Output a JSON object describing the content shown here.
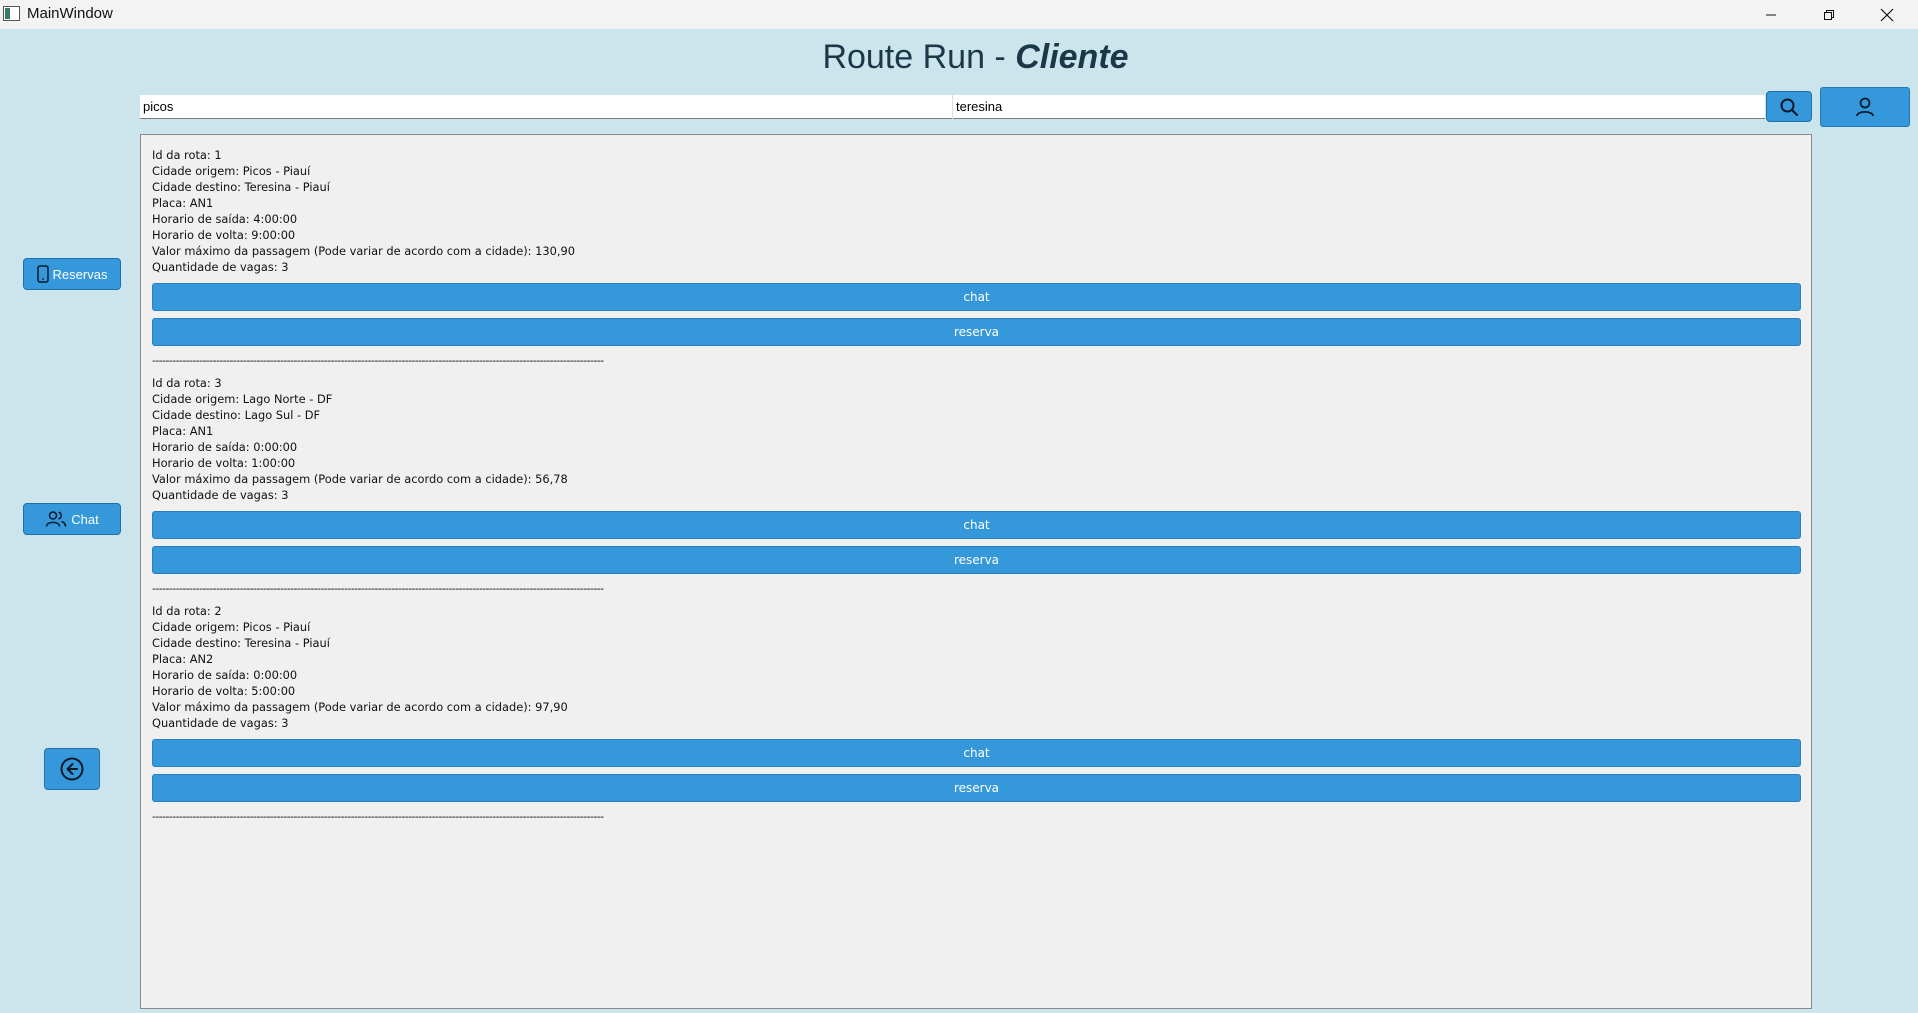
{
  "window": {
    "title": "MainWindow"
  },
  "header": {
    "title_plain": "Route Run - ",
    "title_emphasis": "Cliente"
  },
  "search": {
    "origin_value": "picos",
    "destination_value": "teresina",
    "search_icon": "search-icon",
    "profile_icon": "user-icon"
  },
  "sidebar": {
    "reservas_label": "Reservas",
    "reservas_icon": "phone-icon",
    "chat_label": "Chat",
    "chat_icon": "users-icon",
    "back_icon": "arrow-left-circle-icon"
  },
  "routes": [
    {
      "id": "Id da rota: 1",
      "origin": "Cidade origem: Picos - Piauí",
      "destination": "Cidade destino: Teresina - Piauí",
      "plate": "Placa: AN1",
      "departure": "Horario de saída: 4:00:00",
      "return": "Horario de volta: 9:00:00",
      "max_price": "Valor máximo da passagem (Pode variar de acordo com a cidade): 130,90",
      "seats": "Quantidade de vagas: 3",
      "chat_label": "chat",
      "reserva_label": "reserva",
      "separator": "--------------------------------------------------------------------------------------------------------------------------------------"
    },
    {
      "id": "Id da rota: 3",
      "origin": "Cidade origem: Lago Norte - DF",
      "destination": "Cidade destino: Lago Sul - DF",
      "plate": "Placa: AN1",
      "departure": "Horario de saída: 0:00:00",
      "return": "Horario de volta: 1:00:00",
      "max_price": "Valor máximo da passagem (Pode variar de acordo com a cidade): 56,78",
      "seats": "Quantidade de vagas: 3",
      "chat_label": "chat",
      "reserva_label": "reserva",
      "separator": "--------------------------------------------------------------------------------------------------------------------------------------"
    },
    {
      "id": "Id da rota: 2",
      "origin": "Cidade origem: Picos - Piauí",
      "destination": "Cidade destino: Teresina - Piauí",
      "plate": "Placa: AN2",
      "departure": "Horario de saída: 0:00:00",
      "return": "Horario de volta: 5:00:00",
      "max_price": "Valor máximo da passagem (Pode variar de acordo com a cidade): 97,90",
      "seats": "Quantidade de vagas: 3",
      "chat_label": "chat",
      "reserva_label": "reserva",
      "separator": "--------------------------------------------------------------------------------------------------------------------------------------"
    }
  ],
  "colors": {
    "background": "#cce5ec",
    "accent": "#3498db",
    "panel": "#f0f0f0",
    "title": "#1a3848"
  }
}
